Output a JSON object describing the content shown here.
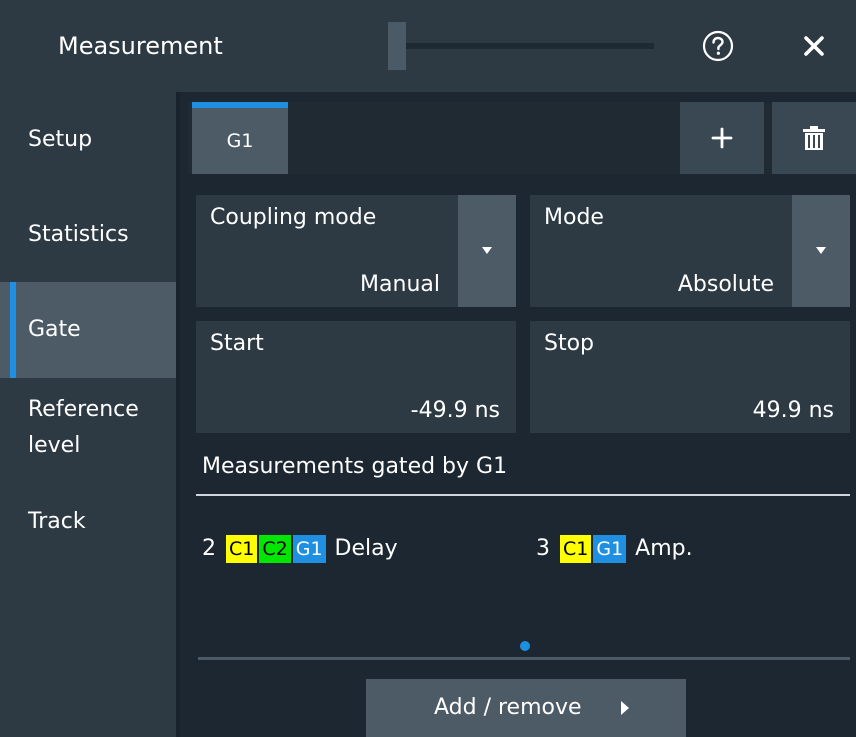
{
  "window": {
    "title": "Measurement",
    "help_icon": "help-circle-icon",
    "close_icon": "close-icon"
  },
  "sidebar": {
    "items": [
      {
        "label": "Setup",
        "active": false
      },
      {
        "label": "Statistics",
        "active": false
      },
      {
        "label": "Gate",
        "active": true
      },
      {
        "label": "Reference level",
        "active": false
      },
      {
        "label": "Track",
        "active": false
      }
    ]
  },
  "tabs": {
    "items": [
      {
        "label": "G1",
        "active": true
      }
    ],
    "add_icon": "plus-icon",
    "delete_icon": "trash-icon"
  },
  "fields": {
    "coupling_mode": {
      "label": "Coupling mode",
      "value": "Manual"
    },
    "mode": {
      "label": "Mode",
      "value": "Absolute"
    },
    "start": {
      "label": "Start",
      "value": "-49.9 ns"
    },
    "stop": {
      "label": "Stop",
      "value": "49.9 ns"
    }
  },
  "gated": {
    "title": "Measurements gated by G1",
    "items": [
      {
        "number": "2",
        "badges": [
          "C1",
          "C2",
          "G1"
        ],
        "name": "Delay"
      },
      {
        "number": "3",
        "badges": [
          "C1",
          "G1"
        ],
        "name": "Amp."
      }
    ]
  },
  "buttons": {
    "add_remove": "Add / remove"
  },
  "colors": {
    "accent": "#1e8fe1",
    "badge_c1": "#ffff00",
    "badge_c2": "#00e600",
    "badge_g1": "#1e8fe1"
  }
}
